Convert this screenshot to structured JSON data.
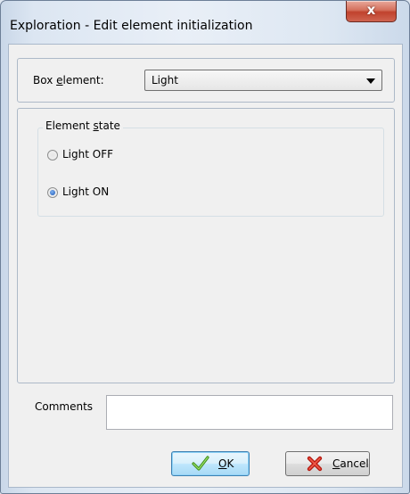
{
  "window": {
    "title": "Exploration - Edit element initialization",
    "close_label": "x"
  },
  "box_element": {
    "label_pre": "Box ",
    "label_accel": "e",
    "label_post": "lement:",
    "value": "Light"
  },
  "element_state": {
    "legend_pre": "Element ",
    "legend_accel": "s",
    "legend_post": "tate",
    "options": [
      {
        "label": "Light OFF",
        "selected": false
      },
      {
        "label": "Light ON",
        "selected": true
      }
    ]
  },
  "comments": {
    "label": "Comments",
    "value": ""
  },
  "buttons": {
    "ok": {
      "accel": "O",
      "rest": "K",
      "icon": "checkmark-icon"
    },
    "cancel": {
      "accel": "C",
      "rest": "ancel",
      "icon": "x-icon"
    }
  }
}
